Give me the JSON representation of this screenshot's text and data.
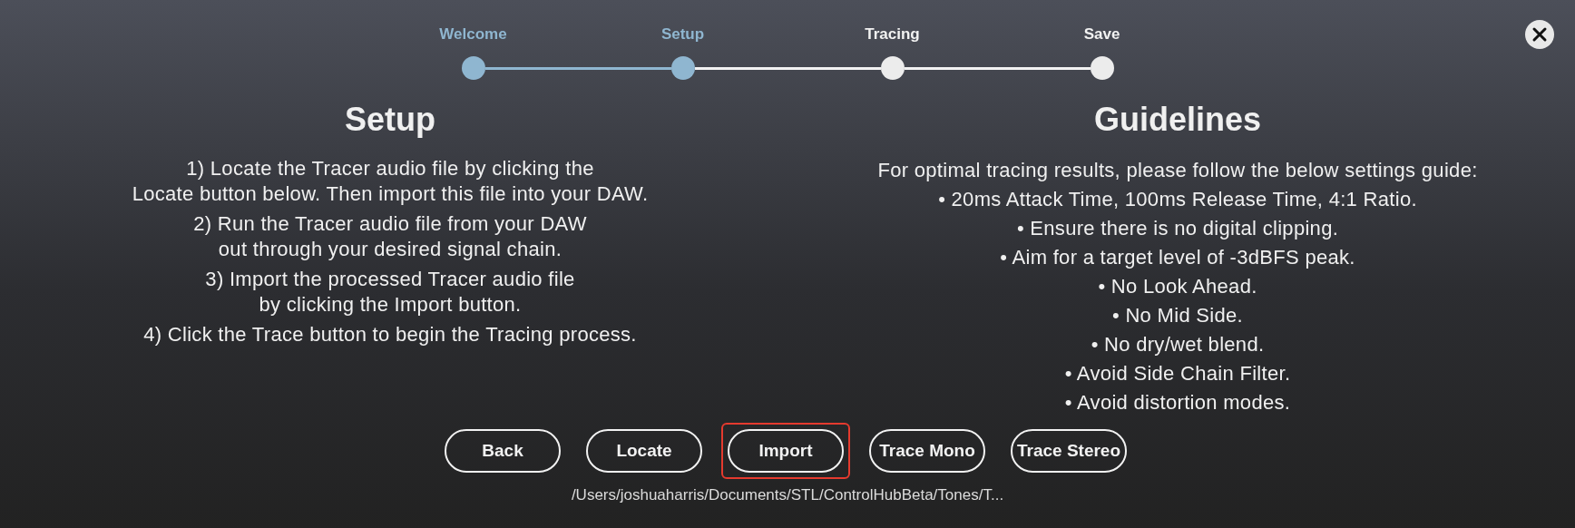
{
  "steps": [
    {
      "label": "Welcome",
      "completed": true
    },
    {
      "label": "Setup",
      "completed": true
    },
    {
      "label": "Tracing",
      "completed": false
    },
    {
      "label": "Save",
      "completed": false
    }
  ],
  "setup": {
    "title": "Setup",
    "paragraphs": [
      [
        "1) Locate the Tracer audio file by clicking the",
        "Locate button below. Then import this file into your DAW."
      ],
      [
        "2) Run the Tracer audio file from your DAW",
        "out through your desired signal chain."
      ],
      [
        "3) Import the processed Tracer audio file",
        "by clicking the Import button."
      ],
      [
        "4) Click the Trace button to begin the Tracing process."
      ]
    ]
  },
  "guidelines": {
    "title": "Guidelines",
    "lines": [
      "For optimal tracing results, please follow the below settings guide:",
      "• 20ms Attack Time, 100ms Release Time, 4:1 Ratio.",
      "• Ensure there is no digital clipping.",
      "• Aim for a target level of -3dBFS peak.",
      "• No Look Ahead.",
      "• No Mid Side.",
      "• No dry/wet blend.",
      "• Avoid Side Chain Filter.",
      "• Avoid distortion modes."
    ]
  },
  "buttons": [
    {
      "label": "Back",
      "focused": false
    },
    {
      "label": "Locate",
      "focused": false
    },
    {
      "label": "Import",
      "focused": true
    },
    {
      "label": "Trace Mono",
      "focused": false
    },
    {
      "label": "Trace Stereo",
      "focused": false
    }
  ],
  "file_path": "/Users/joshuaharris/Documents/STL/ControlHubBeta/Tones/T..."
}
